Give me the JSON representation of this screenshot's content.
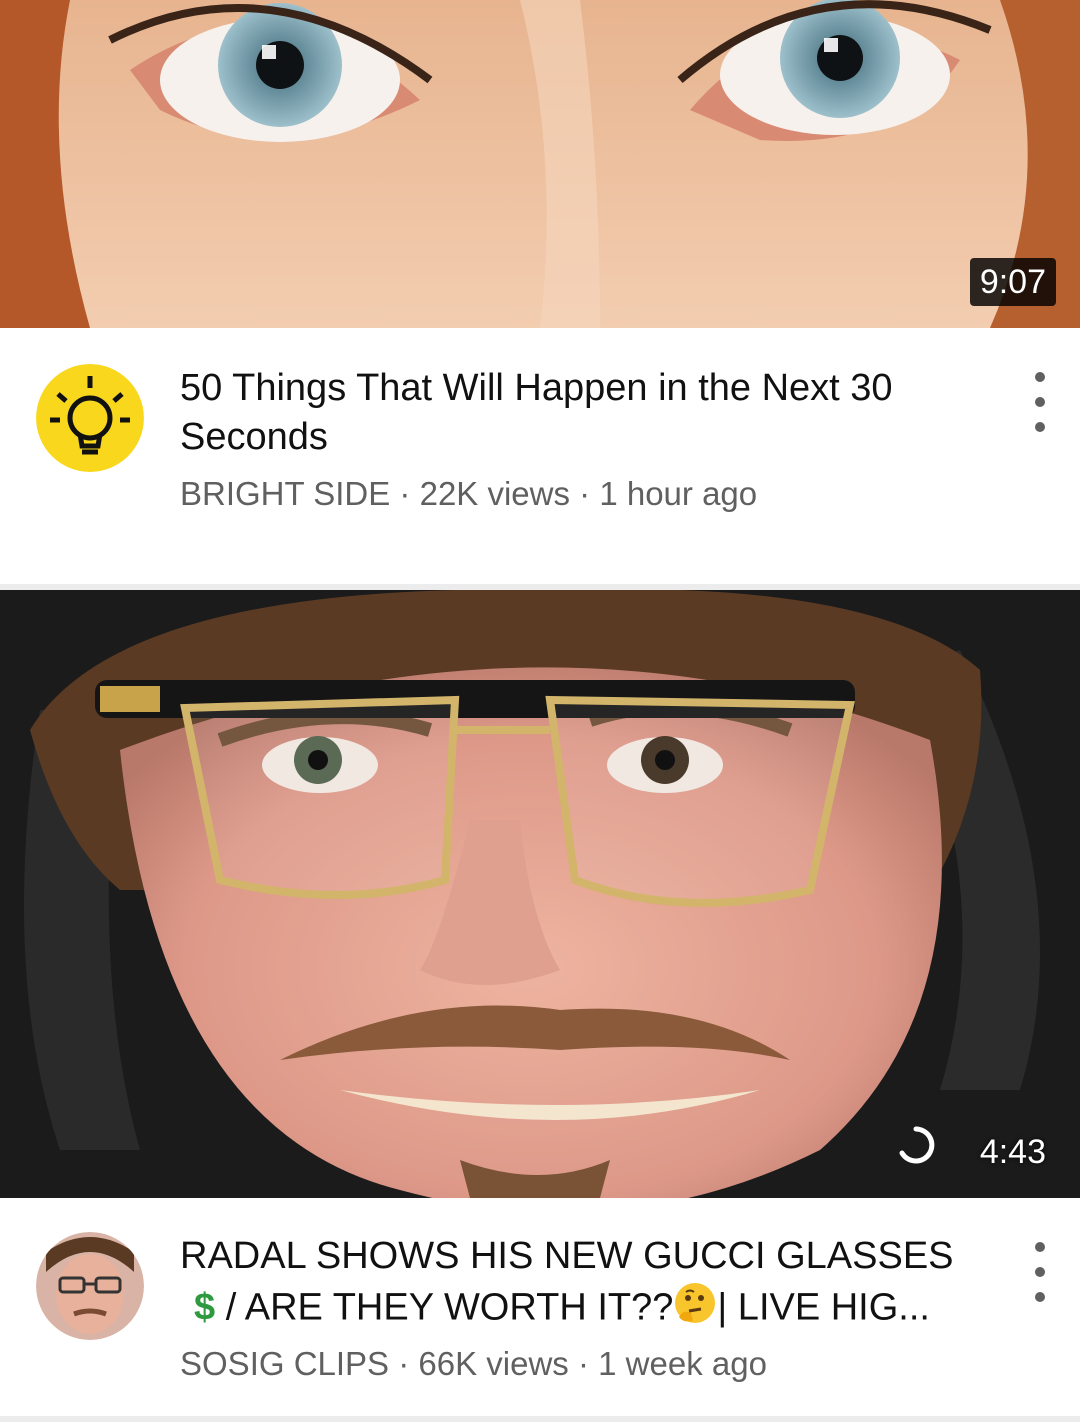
{
  "videos": [
    {
      "title": "50 Things That Will Happen in the Next 30 Seconds",
      "channel": "BRIGHT SIDE",
      "views": "22K views",
      "age": "1 hour ago",
      "duration": "9:07"
    },
    {
      "title_part1": "RADAL SHOWS HIS NEW GUCCI GLASSES",
      "title_dollar": "$",
      "title_part2": " / ARE THEY WORTH IT??",
      "title_part3": "| LIVE HIG...",
      "channel": "SOSIG CLIPS",
      "views": "66K views",
      "age": "1 week ago",
      "duration": "4:43"
    }
  ],
  "separator": " · ",
  "icons": {
    "channel1_avatar": "lightbulb-icon",
    "more": "more-vert-icon",
    "loading": "loading-spinner-icon",
    "emoji": "thinking-face-emoji"
  },
  "colors": {
    "bright_side_yellow": "#f9d71c",
    "meta_gray": "#606060",
    "dollar_green": "#2e9a3f"
  }
}
